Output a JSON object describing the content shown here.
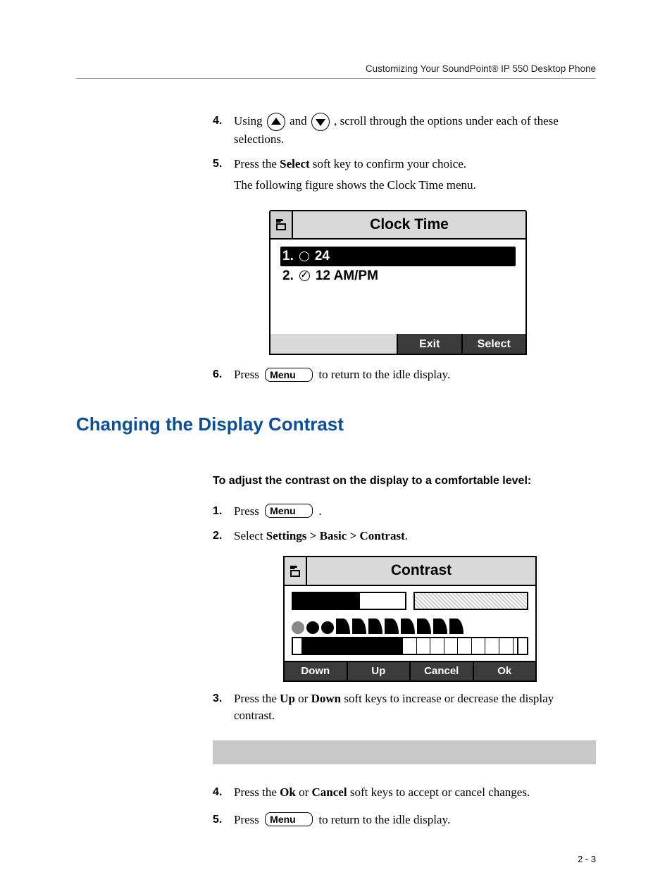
{
  "header": {
    "running": "Customizing Your SoundPoint® IP 550 Desktop Phone"
  },
  "top_steps": {
    "s4": {
      "num": "4.",
      "pre": "Using ",
      "mid": " and ",
      "post": ", scroll through the options under each of these selections."
    },
    "s5": {
      "num": "5.",
      "line1a": "Press the ",
      "bold1": "Select",
      "line1b": " soft key to confirm your choice.",
      "line2": "The following figure shows the Clock Time menu."
    },
    "s6": {
      "num": "6.",
      "pre": "Press ",
      "key": "Menu",
      "post": " to return to the idle display."
    }
  },
  "lcd_clock": {
    "title": "Clock Time",
    "row1": {
      "idx": "1.",
      "label": "24"
    },
    "row2": {
      "idx": "2.",
      "label": "12 AM/PM"
    },
    "sk_exit": "Exit",
    "sk_select": "Select"
  },
  "section": {
    "heading": "Changing the Display Contrast",
    "lead": "To adjust the contrast on the display to a comfortable level:"
  },
  "bottom_steps": {
    "s1": {
      "num": "1.",
      "pre": "Press ",
      "key": "Menu",
      "post": " ."
    },
    "s2": {
      "num": "2.",
      "pre": "Select ",
      "bold": "Settings > Basic > Contrast",
      "post": "."
    },
    "s3": {
      "num": "3.",
      "pre": "Press the ",
      "b1": "Up",
      "mid1": " or ",
      "b2": "Down",
      "post": " soft keys to increase or decrease the display contrast."
    },
    "s4": {
      "num": "4.",
      "pre": "Press the ",
      "b1": "Ok",
      "mid1": " or ",
      "b2": "Cancel",
      "post": " soft keys to accept or cancel changes."
    },
    "s5": {
      "num": "5.",
      "pre": "Press ",
      "key": "Menu",
      "post": " to return to the idle display."
    }
  },
  "lcd_contrast": {
    "title": "Contrast",
    "sk_down": "Down",
    "sk_up": "Up",
    "sk_cancel": "Cancel",
    "sk_ok": "Ok"
  },
  "footer": {
    "pagenum": "2 - 3"
  }
}
